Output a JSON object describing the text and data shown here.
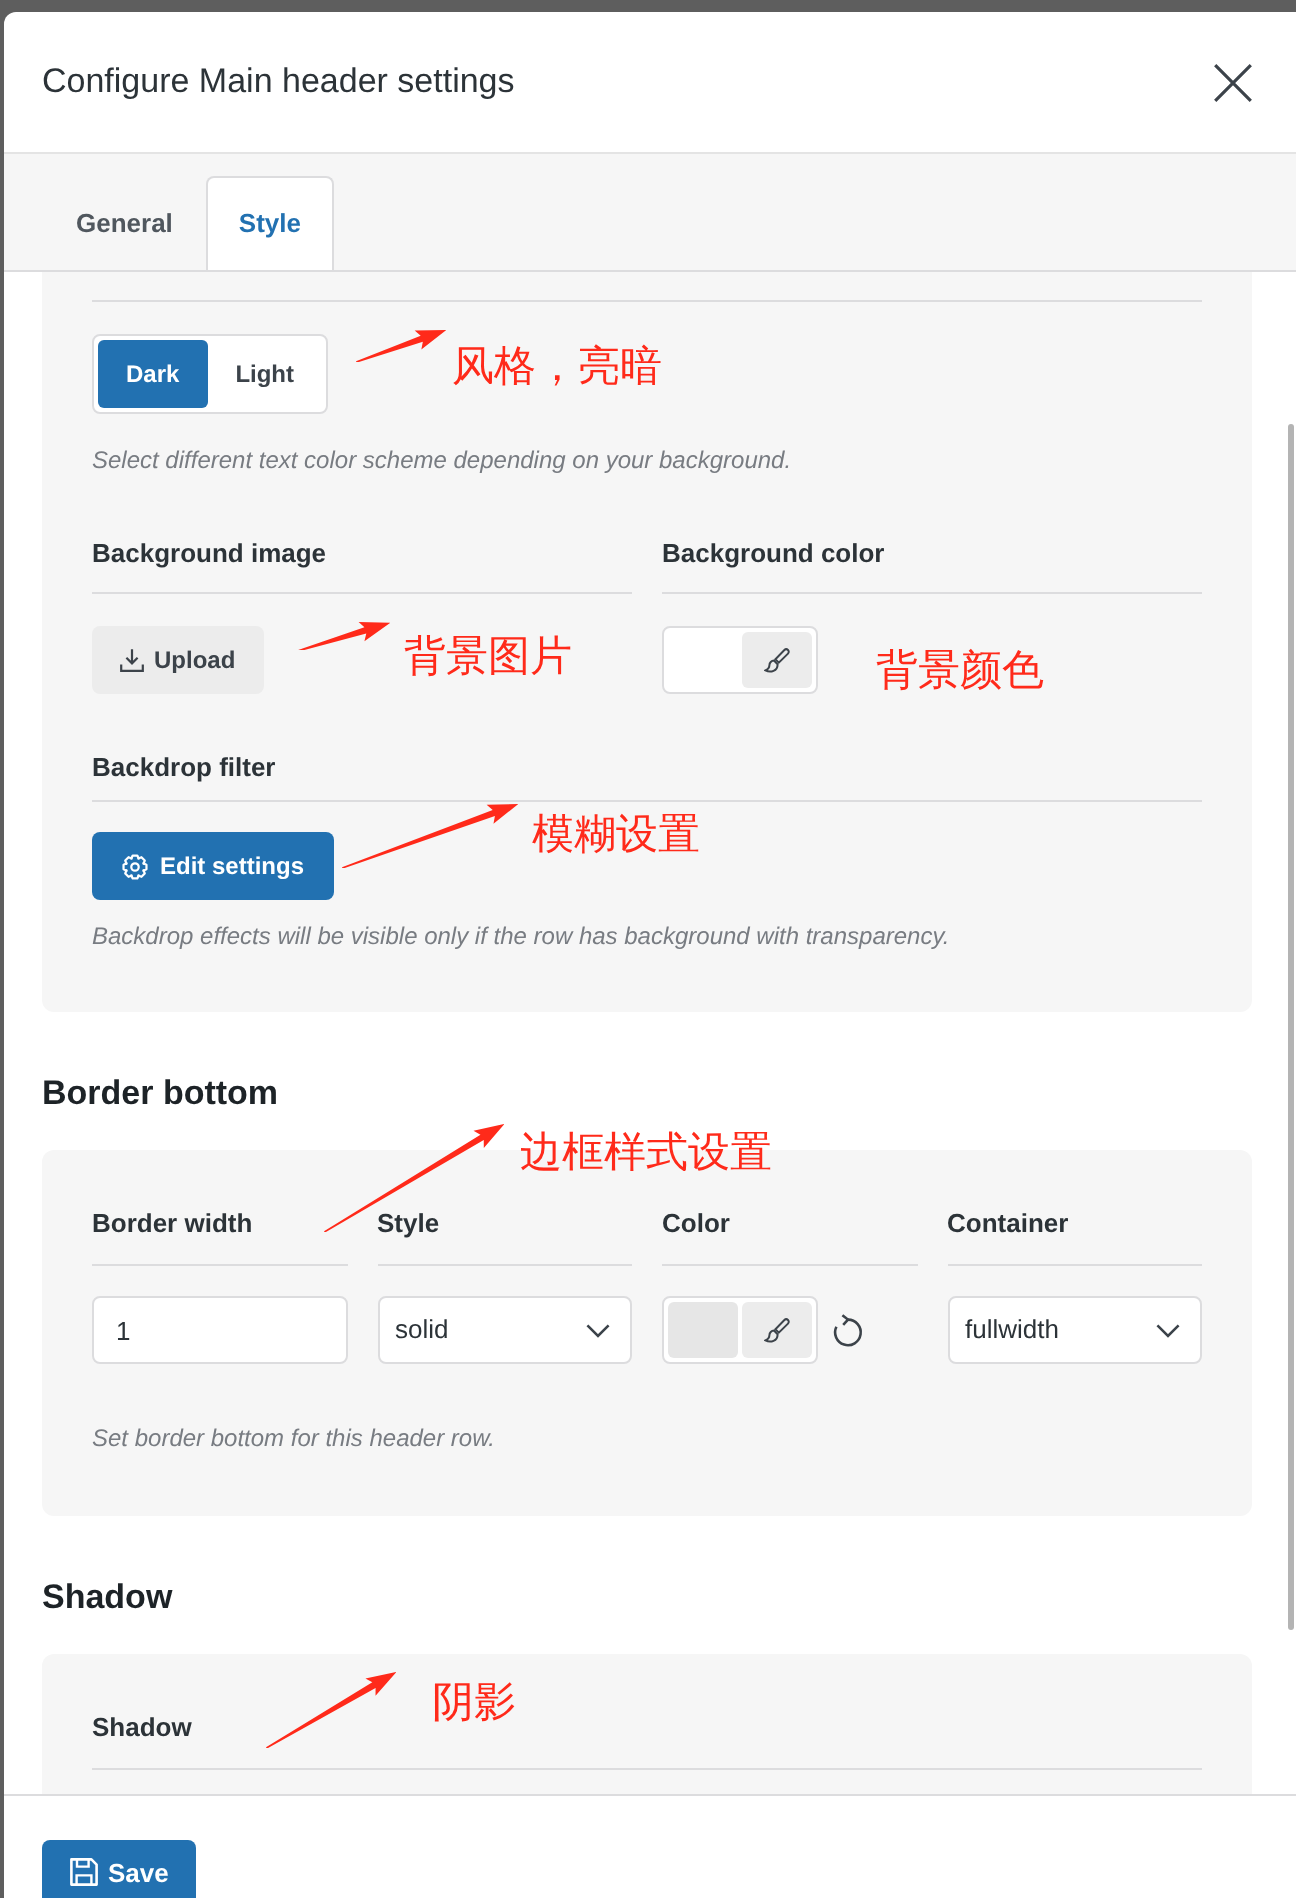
{
  "dialog": {
    "title": "Configure Main header settings"
  },
  "tabs": [
    {
      "label": "General",
      "selected": false
    },
    {
      "label": "Style",
      "selected": true
    }
  ],
  "appearance": {
    "scheme_options": [
      {
        "label": "Dark",
        "selected": true
      },
      {
        "label": "Light",
        "selected": false
      }
    ],
    "scheme_help": "Select different text color scheme depending on your background.",
    "background_image": {
      "label": "Background image",
      "button": "Upload"
    },
    "background_color": {
      "label": "Background color"
    },
    "backdrop_filter": {
      "label": "Backdrop filter",
      "button": "Edit settings",
      "help": "Backdrop effects will be visible only if the row has background with transparency."
    }
  },
  "border_bottom": {
    "heading": "Border bottom",
    "fields": [
      {
        "kind": "number",
        "label": "Border width",
        "value": "1"
      },
      {
        "kind": "select",
        "label": "Style",
        "value": "solid"
      },
      {
        "kind": "color",
        "label": "Color",
        "color": "#e6e6e6"
      },
      {
        "kind": "select",
        "label": "Container",
        "value": "fullwidth"
      }
    ],
    "help": "Set border bottom for this header row."
  },
  "shadow": {
    "heading": "Shadow",
    "label": "Shadow"
  },
  "footer": {
    "save_button": "Save"
  },
  "annotations": [
    {
      "kind": "arrow_label",
      "text": "风格，亮暗"
    },
    {
      "kind": "arrow_label",
      "text": "背景图片"
    },
    {
      "kind": "label",
      "text": "背景颜色"
    },
    {
      "kind": "arrow_label",
      "text": "模糊设置"
    },
    {
      "kind": "arrow_label",
      "text": "边框样式设置"
    },
    {
      "kind": "arrow_label",
      "text": "阴影"
    }
  ]
}
